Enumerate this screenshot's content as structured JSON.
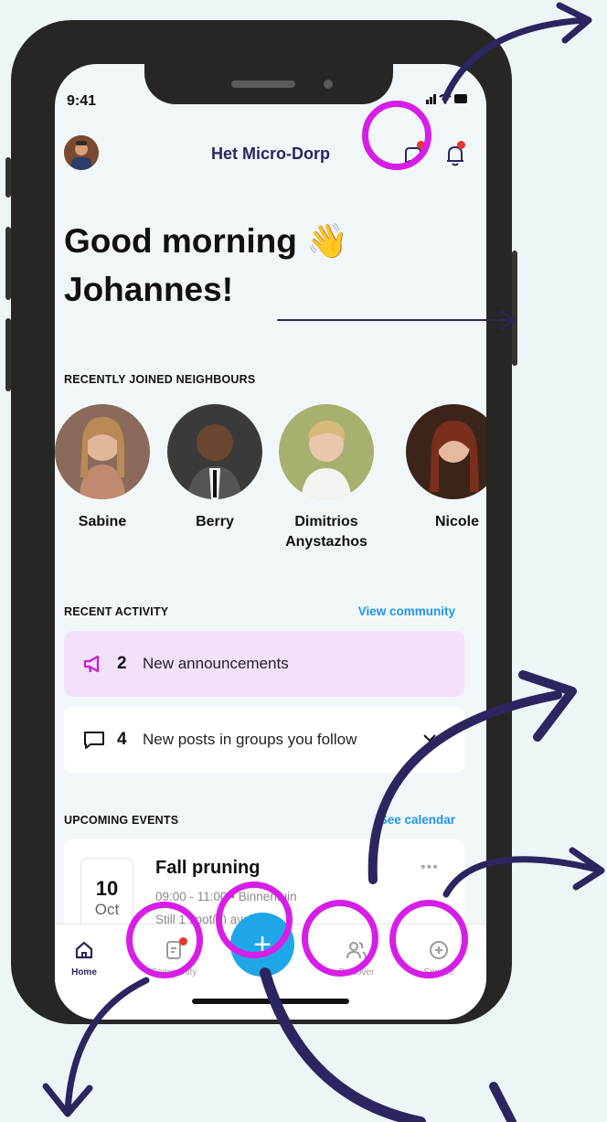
{
  "status_bar": {
    "time": "9:41"
  },
  "header": {
    "app_name": "Het Micro-Dorp"
  },
  "greeting": {
    "line1": "Good morning 👋",
    "line2": "Johannes!"
  },
  "neighbours": {
    "section_label": "RECENTLY JOINED NEIGHBOURS",
    "items": [
      {
        "name": "Sabine"
      },
      {
        "name": "Berry"
      },
      {
        "name": "Dimitrios Anystazhos"
      },
      {
        "name": "Nicole"
      }
    ]
  },
  "activity": {
    "section_label": "RECENT ACTIVITY",
    "link": "View community",
    "announcements": {
      "count": "2",
      "text": "New announcements"
    },
    "posts": {
      "count": "4",
      "text": "New posts in groups you follow"
    }
  },
  "events": {
    "section_label": "UPCOMING EVENTS",
    "link": "See calendar",
    "items": [
      {
        "day": "10",
        "month": "Oct",
        "title": "Fall pruning",
        "time": "09:00 - 11:00 • Binnentuin",
        "note": "Still 1 spot(s) available"
      }
    ]
  },
  "tabs": [
    {
      "label": "Home"
    },
    {
      "label": "Community"
    },
    {
      "label": "Discover"
    },
    {
      "label": "Service"
    }
  ],
  "fab": {
    "label": "+"
  },
  "colors": {
    "accent": "#1ea6e8",
    "highlight": "#d61ee6",
    "brand": "#2b2560",
    "announcement_bg": "#f3e1fb",
    "notification_dot": "#e8352f",
    "arrow": "#2b2560"
  }
}
